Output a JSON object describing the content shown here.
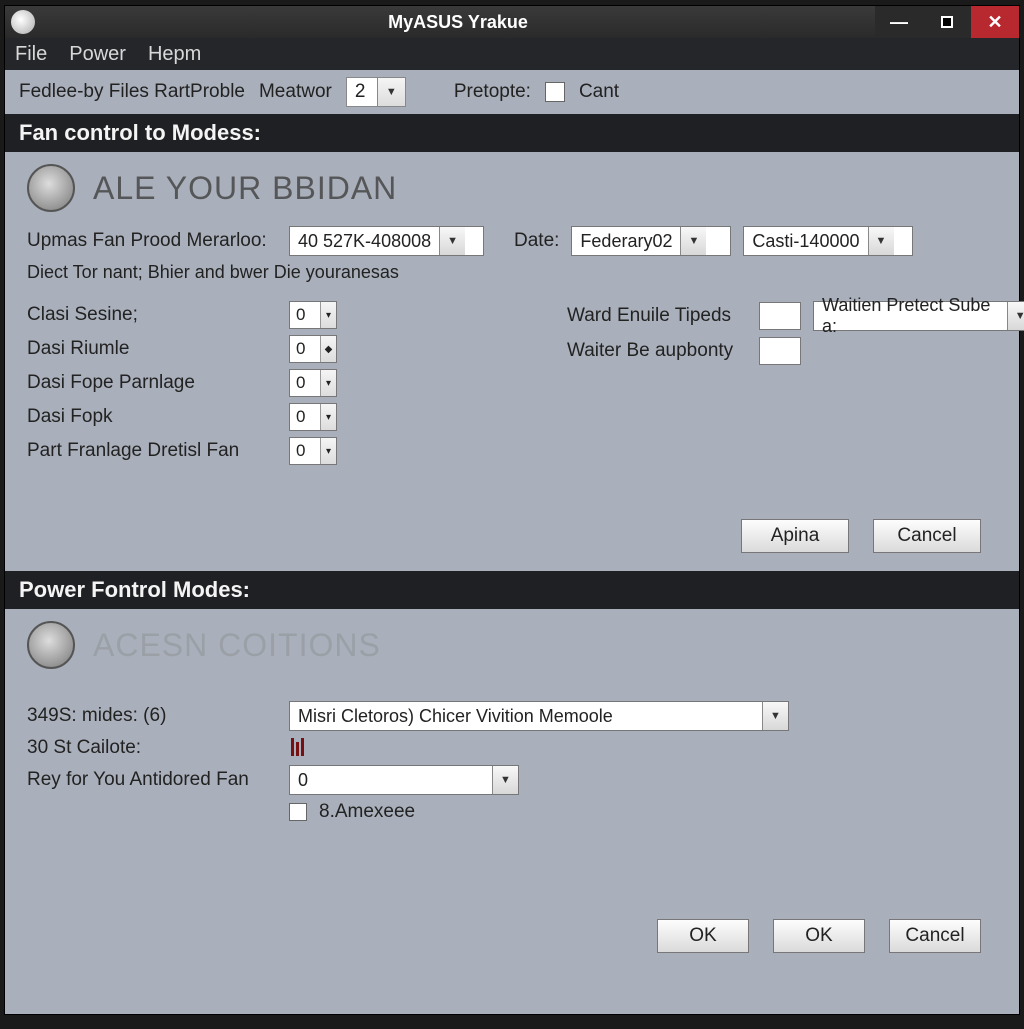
{
  "window": {
    "title": "MyASUS Yrakue"
  },
  "menubar": {
    "file": "File",
    "power": "Power",
    "help": "Hepm"
  },
  "toolbar": {
    "files_label": "Fedlee-by Files RartProble",
    "meatwor_label": "Meatwor",
    "meatwor_value": "2",
    "pretopte_label": "Pretopte:",
    "cant_label": "Cant"
  },
  "section1": {
    "header": "Fan control to Modess:",
    "title": "ALE YOUR BBIDAN",
    "prod_label": "Upmas Fan Prood Merarloo:",
    "prod_value": "40 527K-408008",
    "date_label": "Date:",
    "date_value": "Federary02",
    "casti_value": "Casti-140000",
    "helper": "Diect Tor nant; Bhier and bwer Die youranesas",
    "fields": {
      "clasi_sesine": {
        "label": "Clasi Sesine;",
        "value": "0"
      },
      "dasi_riumle": {
        "label": "Dasi Riumle",
        "value": "0"
      },
      "dasi_fope_parnlage": {
        "label": "Dasi Fope Parnlage",
        "value": "0"
      },
      "dasi_fopk": {
        "label": "Dasi Fopk",
        "value": "0"
      },
      "part_franlage": {
        "label": "Part Franlage Dretisl Fan",
        "value": "0"
      }
    },
    "right": {
      "ward_label": "Ward Enuile Tipeds",
      "ward_value": "",
      "waiten_select": "Waitien Pretect Sube a:",
      "waiter_label": "Waiter Be aupbonty",
      "waiter_value": ""
    },
    "buttons": {
      "apina": "Apina",
      "cancel": "Cancel"
    }
  },
  "section2": {
    "header": "Power Fontrol Modes:",
    "title": "ACESN COITIONS",
    "s349_label": "349S: mides: (6)",
    "s349_value": "Misri Cletoros) Chicer Vivition Memoole",
    "st_label": "30 St Cailote:",
    "rey_label": "Rey for You Antidored Fan",
    "rey_value": "0",
    "chk_label": "8.Amexeee",
    "buttons": {
      "ok1": "OK",
      "ok2": "OK",
      "cancel": "Cancel"
    }
  }
}
